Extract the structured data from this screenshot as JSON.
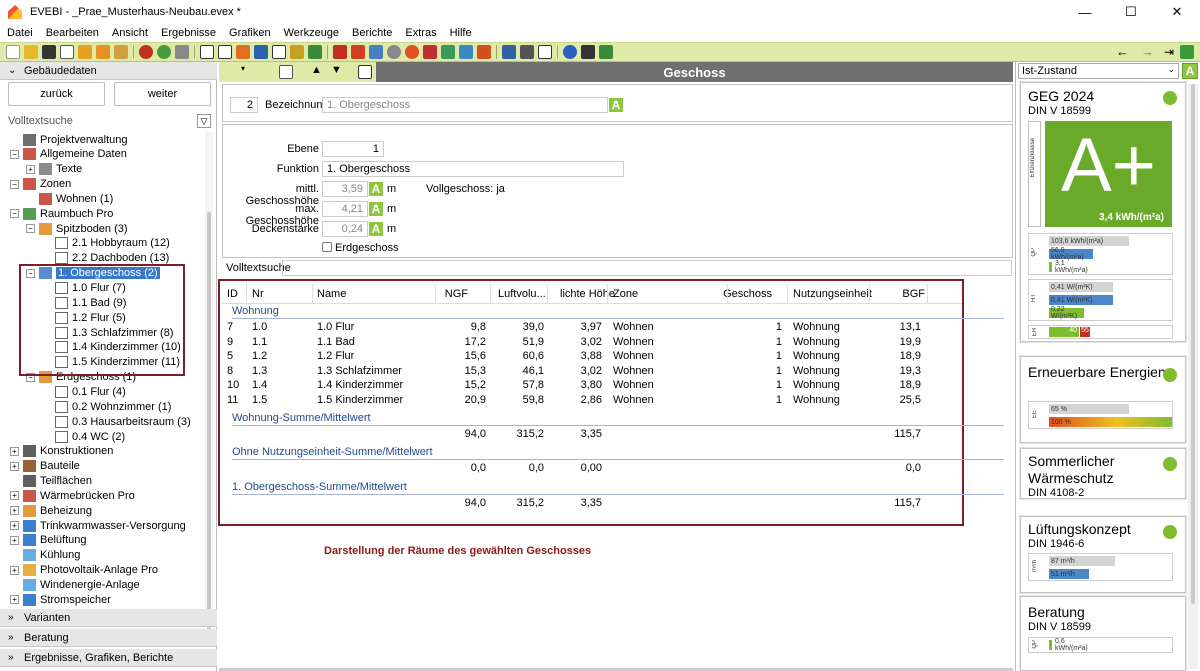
{
  "window": {
    "title": "EVEBI  - _Prae_Musterhaus-Neubau.evex *",
    "min": "—",
    "max": "☐",
    "close": "✕"
  },
  "menu": [
    "Datei",
    "Bearbeiten",
    "Ansicht",
    "Ergebnisse",
    "Grafiken",
    "Werkzeuge",
    "Berichte",
    "Extras",
    "Hilfe"
  ],
  "left": {
    "header": "Gebäudedaten",
    "back": "zurück",
    "next": "weiter",
    "search_label": "Volltextsuche",
    "tree": [
      {
        "label": "Projektverwaltung",
        "level": 1,
        "icon": "#555",
        "exp": ""
      },
      {
        "label": "Allgemeine Daten",
        "level": 1,
        "icon": "#c0392b",
        "exp": "−"
      },
      {
        "label": "Texte",
        "level": 2,
        "icon": "#777",
        "exp": "+"
      },
      {
        "label": "Zonen",
        "level": 1,
        "icon": "#c0392b",
        "exp": "−"
      },
      {
        "label": "Wohnen (1)",
        "level": 2,
        "icon": "#c0392b",
        "exp": ""
      },
      {
        "label": "Raumbuch Pro",
        "level": 1,
        "icon": "#3a8a3a",
        "exp": "−"
      },
      {
        "label": "Spitzboden (3)",
        "level": 2,
        "icon": "#e08a1a",
        "exp": "−"
      },
      {
        "label": "2.1 Hobbyraum (12)",
        "level": 3,
        "icon": "#666",
        "exp": ""
      },
      {
        "label": "2.2 Dachboden (13)",
        "level": 3,
        "icon": "#666",
        "exp": ""
      },
      {
        "label": "1. Obergeschoss (2)",
        "level": 2,
        "icon": "#3878c8",
        "exp": "−",
        "selected": true
      },
      {
        "label": "1.0 Flur (7)",
        "level": 3,
        "icon": "#666",
        "exp": ""
      },
      {
        "label": "1.1 Bad (9)",
        "level": 3,
        "icon": "#666",
        "exp": ""
      },
      {
        "label": "1.2 Flur (5)",
        "level": 3,
        "icon": "#666",
        "exp": ""
      },
      {
        "label": "1.3 Schlafzimmer (8)",
        "level": 3,
        "icon": "#666",
        "exp": ""
      },
      {
        "label": "1.4 Kinderzimmer (10)",
        "level": 3,
        "icon": "#666",
        "exp": ""
      },
      {
        "label": "1.5 Kinderzimmer (11)",
        "level": 3,
        "icon": "#666",
        "exp": ""
      },
      {
        "label": "Erdgeschoss (1)",
        "level": 2,
        "icon": "#e08a1a",
        "exp": "−"
      },
      {
        "label": "0.1 Flur (4)",
        "level": 3,
        "icon": "#666",
        "exp": ""
      },
      {
        "label": "0.2 Wohnzimmer (1)",
        "level": 3,
        "icon": "#666",
        "exp": ""
      },
      {
        "label": "0.3 Hausarbeitsraum (3)",
        "level": 3,
        "icon": "#666",
        "exp": ""
      },
      {
        "label": "0.4 WC (2)",
        "level": 3,
        "icon": "#666",
        "exp": ""
      },
      {
        "label": "Konstruktionen",
        "level": 1,
        "icon": "#444",
        "exp": "+"
      },
      {
        "label": "Bauteile",
        "level": 1,
        "icon": "#8b4513",
        "exp": "+"
      },
      {
        "label": "Teilflächen",
        "level": 1,
        "icon": "#444",
        "exp": ""
      },
      {
        "label": "Wärmebrücken Pro",
        "level": 1,
        "icon": "#c0392b",
        "exp": "+"
      },
      {
        "label": "Beheizung",
        "level": 1,
        "icon": "#e08a1a",
        "exp": "+"
      },
      {
        "label": "Trinkwarmwasser-Versorgung",
        "level": 1,
        "icon": "#1a6ac8",
        "exp": "+"
      },
      {
        "label": "Belüftung",
        "level": 1,
        "icon": "#1a6ac8",
        "exp": "+"
      },
      {
        "label": "Kühlung",
        "level": 1,
        "icon": "#4aa0e0",
        "exp": ""
      },
      {
        "label": "Photovoltaik-Anlage Pro",
        "level": 1,
        "icon": "#e0a020",
        "exp": "+"
      },
      {
        "label": "Windenergie-Anlage",
        "level": 1,
        "icon": "#4aa0e0",
        "exp": ""
      },
      {
        "label": "Stromspeicher",
        "level": 1,
        "icon": "#1a6ac8",
        "exp": "+"
      }
    ],
    "bottom_sections": [
      "Varianten",
      "Beratung",
      "Ergebnisse, Grafiken, Berichte"
    ]
  },
  "center": {
    "header": "Geschoss",
    "nr": "2",
    "bezeichnung_label": "Bezeichnung",
    "bezeichnung_value": "1. Obergeschoss",
    "a": "A",
    "m": "m",
    "fields": {
      "ebene_label": "Ebene",
      "ebene": "1",
      "funktion_label": "Funktion",
      "funktion": "1. Obergeschoss",
      "mgh_label": "mittl. Geschosshöhe",
      "mgh": "3,59",
      "maxgh_label": "max. Geschosshöhe",
      "maxgh": "4,21",
      "deck_label": "Deckenstärke",
      "deck": "0,24",
      "voll": "Vollgeschoss: ja",
      "erdg": "Erdgeschoss"
    },
    "search_label": "Volltextsuche",
    "columns": [
      "ID",
      "Nr",
      "Name",
      "NGF",
      "Luftvolu...",
      "lichte Höhe",
      "Zone",
      "Geschoss",
      "Nutzungseinheit",
      "BGF"
    ],
    "group1": "Wohnung",
    "rows": [
      [
        "7",
        "1.0",
        "1.0 Flur",
        "9,8",
        "39,0",
        "3,97",
        "Wohnen",
        "1",
        "Wohnung",
        "13,1"
      ],
      [
        "9",
        "1.1",
        "1.1 Bad",
        "17,2",
        "51,9",
        "3,02",
        "Wohnen",
        "1",
        "Wohnung",
        "19,9"
      ],
      [
        "5",
        "1.2",
        "1.2 Flur",
        "15,6",
        "60,6",
        "3,88",
        "Wohnen",
        "1",
        "Wohnung",
        "18,9"
      ],
      [
        "8",
        "1.3",
        "1.3 Schlafzimmer",
        "15,3",
        "46,1",
        "3,02",
        "Wohnen",
        "1",
        "Wohnung",
        "19,3"
      ],
      [
        "10",
        "1.4",
        "1.4 Kinderzimmer",
        "15,2",
        "57,8",
        "3,80",
        "Wohnen",
        "1",
        "Wohnung",
        "18,9"
      ],
      [
        "11",
        "1.5",
        "1.5 Kinderzimmer",
        "20,9",
        "59,8",
        "2,86",
        "Wohnen",
        "1",
        "Wohnung",
        "25,5"
      ]
    ],
    "sums": [
      {
        "label": "Wohnung-Summe/Mittelwert",
        "ngf": "94,0",
        "luft": "315,2",
        "lh": "3,35",
        "bgf": "115,7"
      },
      {
        "label": "Ohne Nutzungseinheit-Summe/Mittelwert",
        "ngf": "0,0",
        "luft": "0,0",
        "lh": "0,00",
        "bgf": "0,0"
      },
      {
        "label": "1. Obergeschoss-Summe/Mittelwert",
        "ngf": "94,0",
        "luft": "315,2",
        "lh": "3,35",
        "bgf": "115,7"
      }
    ],
    "caption": "Darstellung der Räume des gewählten Geschosses"
  },
  "right": {
    "state": "Ist-Zustand",
    "a": "A",
    "geg": {
      "title": "GEG 2024",
      "sub": "DIN V 18599",
      "rating": "A+",
      "value": "3,4 kWh/(m²a)",
      "vlabel": "Effizienzklasse",
      "qp": {
        "label": "QP",
        "bars": [
          "103,6 kWh/(m²a)",
          "56,9 kWh/(m²a)",
          "3,1 kWh/(m²a)"
        ]
      },
      "ht": {
        "label": "HT",
        "bars": [
          "0,41 W/(m²K)",
          "0,41 W/(m²K)",
          "0,22 W/(m²K)"
        ]
      },
      "eh": {
        "label": "EH",
        "v1": "40",
        "v2": "55"
      }
    },
    "ee": {
      "title": "Erneuerbare Energien",
      "label": "EE",
      "bars": [
        "65 %",
        "100 %"
      ]
    },
    "sw": {
      "title": "Sommerlicher Wärmeschutz",
      "sub": "DIN 4108-2"
    },
    "lk": {
      "title": "Lüftungskonzept",
      "sub": "DIN 1946-6",
      "label": "m³/h",
      "bars": [
        "87 m³/h",
        "51 m³/h"
      ]
    },
    "ber": {
      "title": "Beratung",
      "sub": "DIN V 18599",
      "label": "QP",
      "bars": [
        "0,6 kWh/(m²a)"
      ]
    }
  }
}
